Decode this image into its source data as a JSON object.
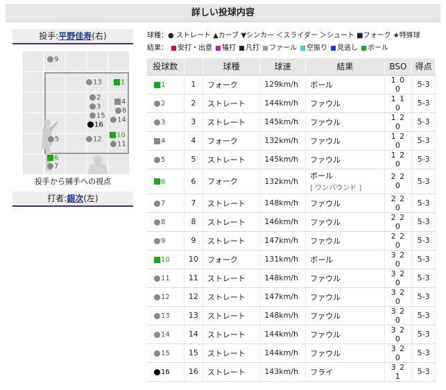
{
  "title": "詳しい投球内容",
  "pitcher": {
    "prefix": "投手:",
    "name": "平野佳寿",
    "hand": "(右)"
  },
  "batter": {
    "prefix": "打者:",
    "name": "銀次",
    "hand": "(左)"
  },
  "zone_caption": "投手から捕手への視点",
  "legend": {
    "types_line": "球種：● ストレート ▲カーブ ▼シンカー ＜スライダー ＞シュート ■フォーク ★特殊球",
    "results_label": "結果：",
    "results": [
      {
        "label": "安打・出塁",
        "color": "#e8003a"
      },
      {
        "label": "犠打",
        "color": "#c21ab0"
      },
      {
        "label": "凡打",
        "color": "#222222"
      },
      {
        "label": "ファール",
        "color": "#999999"
      },
      {
        "label": "空振り",
        "color": "#3fc7e0"
      },
      {
        "label": "見逃し",
        "color": "#1f3fd0"
      },
      {
        "label": "ボール",
        "color": "#1ea51e"
      }
    ]
  },
  "zone_markers": [
    {
      "num": "9",
      "shape": "circle",
      "color": "gray"
    },
    {
      "num": "13",
      "shape": "circle",
      "color": "gray"
    },
    {
      "num": "1",
      "shape": "square",
      "color": "green"
    },
    {
      "num": "2",
      "shape": "circle",
      "color": "gray"
    },
    {
      "num": "3",
      "shape": "circle",
      "color": "gray"
    },
    {
      "num": "4",
      "shape": "square",
      "color": "gray"
    },
    {
      "num": "8",
      "shape": "circle",
      "color": "gray"
    },
    {
      "num": "15",
      "shape": "circle",
      "color": "gray"
    },
    {
      "num": "14",
      "shape": "circle",
      "color": "gray"
    },
    {
      "num": "16",
      "shape": "circle",
      "color": "black"
    },
    {
      "num": "10",
      "shape": "square",
      "color": "green"
    },
    {
      "num": "5",
      "shape": "circle",
      "color": "gray"
    },
    {
      "num": "12",
      "shape": "circle",
      "color": "gray"
    },
    {
      "num": "11",
      "shape": "circle",
      "color": "gray"
    },
    {
      "num": "6",
      "shape": "square",
      "color": "green"
    },
    {
      "num": "7",
      "shape": "circle",
      "color": "gray"
    }
  ],
  "table": {
    "headers": [
      "投球数",
      "球種",
      "球速",
      "結果",
      "BSO",
      "得点"
    ],
    "rows": [
      {
        "mark": "1",
        "shape": "square",
        "color": "green",
        "no": "1",
        "type": "フォーク",
        "speed": "129km/h",
        "result": "ボール",
        "note": "",
        "bso": "100",
        "score": "5-3"
      },
      {
        "mark": "2",
        "shape": "circle",
        "color": "gray",
        "no": "2",
        "type": "ストレート",
        "speed": "144km/h",
        "result": "ファウル",
        "note": "",
        "bso": "110",
        "score": "5-3"
      },
      {
        "mark": "3",
        "shape": "circle",
        "color": "gray",
        "no": "3",
        "type": "ストレート",
        "speed": "145km/h",
        "result": "ファウル",
        "note": "",
        "bso": "120",
        "score": "5-3"
      },
      {
        "mark": "4",
        "shape": "square",
        "color": "gray",
        "no": "4",
        "type": "フォーク",
        "speed": "132km/h",
        "result": "ファウル",
        "note": "",
        "bso": "120",
        "score": "5-3"
      },
      {
        "mark": "5",
        "shape": "circle",
        "color": "gray",
        "no": "5",
        "type": "ストレート",
        "speed": "145km/h",
        "result": "ファウル",
        "note": "",
        "bso": "120",
        "score": "5-3"
      },
      {
        "mark": "6",
        "shape": "square",
        "color": "green",
        "no": "6",
        "type": "フォーク",
        "speed": "132km/h",
        "result": "ボール",
        "note": "[ ワンバウンド ]",
        "bso": "220",
        "score": "5-3"
      },
      {
        "mark": "7",
        "shape": "circle",
        "color": "gray",
        "no": "7",
        "type": "ストレート",
        "speed": "148km/h",
        "result": "ファウル",
        "note": "",
        "bso": "220",
        "score": "5-3"
      },
      {
        "mark": "8",
        "shape": "circle",
        "color": "gray",
        "no": "8",
        "type": "ストレート",
        "speed": "146km/h",
        "result": "ファウル",
        "note": "",
        "bso": "220",
        "score": "5-3"
      },
      {
        "mark": "9",
        "shape": "circle",
        "color": "gray",
        "no": "9",
        "type": "ストレート",
        "speed": "147km/h",
        "result": "ファウル",
        "note": "",
        "bso": "220",
        "score": "5-3"
      },
      {
        "mark": "10",
        "shape": "square",
        "color": "green",
        "no": "10",
        "type": "フォーク",
        "speed": "131km/h",
        "result": "ボール",
        "note": "",
        "bso": "320",
        "score": "5-3"
      },
      {
        "mark": "11",
        "shape": "circle",
        "color": "gray",
        "no": "11",
        "type": "ストレート",
        "speed": "148km/h",
        "result": "ファウル",
        "note": "",
        "bso": "320",
        "score": "5-3"
      },
      {
        "mark": "12",
        "shape": "circle",
        "color": "gray",
        "no": "12",
        "type": "ストレート",
        "speed": "147km/h",
        "result": "ファウル",
        "note": "",
        "bso": "320",
        "score": "5-3"
      },
      {
        "mark": "13",
        "shape": "circle",
        "color": "gray",
        "no": "13",
        "type": "ストレート",
        "speed": "148km/h",
        "result": "ファウル",
        "note": "",
        "bso": "320",
        "score": "5-3"
      },
      {
        "mark": "14",
        "shape": "circle",
        "color": "gray",
        "no": "14",
        "type": "ストレート",
        "speed": "144km/h",
        "result": "ファウル",
        "note": "",
        "bso": "320",
        "score": "5-3"
      },
      {
        "mark": "15",
        "shape": "circle",
        "color": "gray",
        "no": "15",
        "type": "ストレート",
        "speed": "144km/h",
        "result": "ファウル",
        "note": "",
        "bso": "320",
        "score": "5-3"
      },
      {
        "mark": "16",
        "shape": "circle",
        "color": "black",
        "no": "16",
        "type": "ストレート",
        "speed": "143km/h",
        "result": "フライ",
        "note": "",
        "bso": "321",
        "score": "5-3"
      }
    ]
  }
}
